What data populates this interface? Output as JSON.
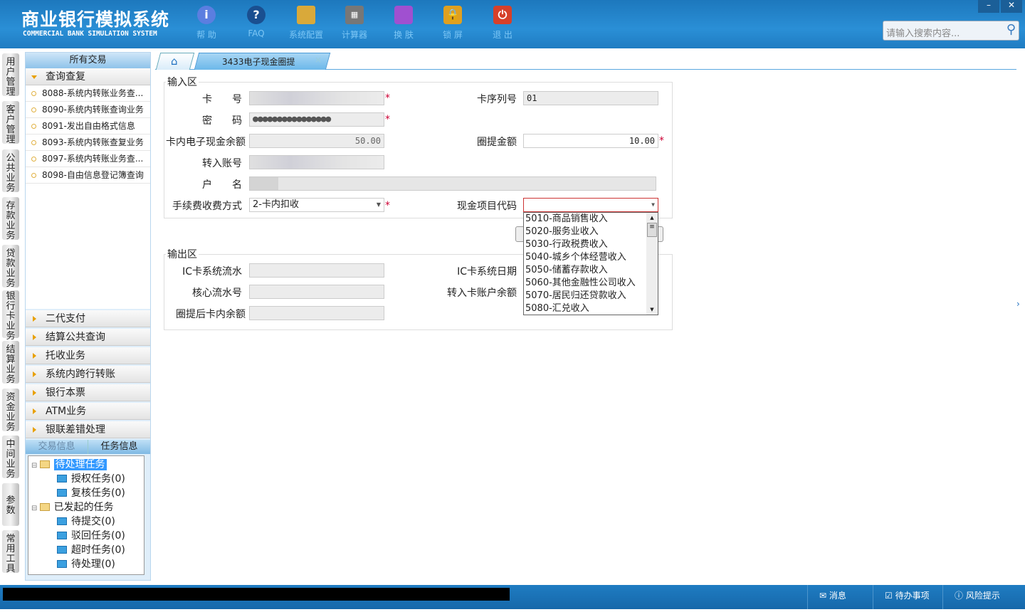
{
  "header": {
    "title_cn": "商业银行模拟系统",
    "title_en": "COMMERCIAL BANK SIMULATION SYSTEM",
    "toolbar": [
      {
        "label": "帮 助",
        "icon": "info-icon"
      },
      {
        "label": "FAQ",
        "icon": "question-icon"
      },
      {
        "label": "系统配置",
        "icon": "toolbox-icon"
      },
      {
        "label": "计算器",
        "icon": "calculator-icon"
      },
      {
        "label": "换 肤",
        "icon": "shirt-icon"
      },
      {
        "label": "锁 屏",
        "icon": "lock-icon"
      },
      {
        "label": "退 出",
        "icon": "power-icon"
      }
    ],
    "search_placeholder": "请输入搜索内容...",
    "minimize": "–",
    "close": "✕"
  },
  "vtabs": [
    "用户管理",
    "客户管理",
    "公共业务",
    "存款业务",
    "贷款业务",
    "银行卡业务",
    "结算业务",
    "资金业务",
    "中间业务",
    "参数",
    "常用工具"
  ],
  "sidebar": {
    "header": "所有交易",
    "open_group": "查询查复",
    "items": [
      "8088-系统内转账业务查...",
      "8090-系统内转账查询业务",
      "8091-发出自由格式信息",
      "8093-系统内转账查复业务",
      "8097-系统内转账业务查...",
      "8098-自由信息登记簿查询"
    ],
    "groups": [
      "二代支付",
      "结算公共查询",
      "托收业务",
      "系统内跨行转账",
      "银行本票",
      "ATM业务",
      "银联差错处理"
    ],
    "info_tabs": [
      "交易信息",
      "任务信息"
    ],
    "tree": [
      {
        "label": "待处理任务",
        "children": [
          "授权任务(0)",
          "复核任务(0)"
        ]
      },
      {
        "label": "已发起的任务",
        "children": [
          "待提交(0)",
          "驳回任务(0)",
          "超时任务(0)",
          "待处理(0)"
        ]
      }
    ]
  },
  "tabs": {
    "active": "3433电子现金圈提",
    "close": "×"
  },
  "form": {
    "input_legend": "输入区",
    "output_legend": "输出区",
    "card_no_label": "卡　　号",
    "card_seq_label": "卡序列号",
    "card_seq": "01",
    "password_label": "密　　码",
    "password": "●●●●●●●●●●●●●●●●",
    "balance_label": "卡内电子现金余额",
    "balance": "50.00",
    "amount_label": "圈提金额",
    "amount": "10.00",
    "to_account_label": "转入账号",
    "name_label": "户　　名",
    "fee_label": "手续费收费方式",
    "fee_value": "2-卡内扣收",
    "cash_code_label": "现金项目代码",
    "cash_code_value": "",
    "cash_code_options": [
      "5010-商品销售收入",
      "5020-服务业收入",
      "5030-行政税费收入",
      "5040-城乡个体经营收入",
      "5050-储蓄存款收入",
      "5060-其他金融性公司收入",
      "5070-居民归还贷款收入",
      "5080-汇兑收入"
    ],
    "out_ic_serial": "IC卡系统流水",
    "out_ic_date": "IC卡系统日期",
    "out_core_serial": "核心流水号",
    "out_to_balance": "转入卡账户余额",
    "out_after_balance": "圈提后卡内余额"
  },
  "status": {
    "message": "消息",
    "todo": "待办事项",
    "risk": "风险提示"
  }
}
